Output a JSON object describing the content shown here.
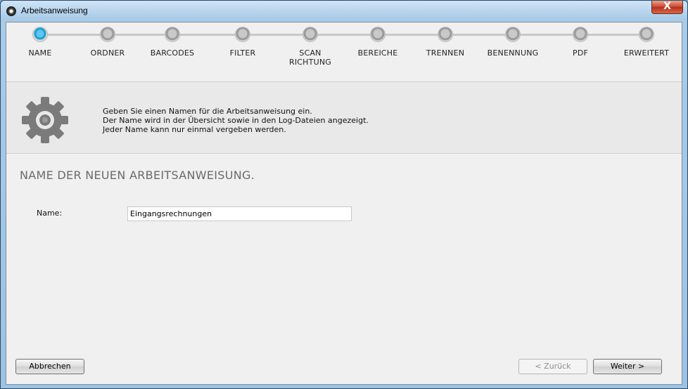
{
  "window": {
    "title": "Arbeitsanweisung",
    "close_label": "X"
  },
  "steps": [
    {
      "label": "NAME",
      "active": true
    },
    {
      "label": "ORDNER",
      "active": false
    },
    {
      "label": "BARCODES",
      "active": false
    },
    {
      "label": "FILTER",
      "active": false
    },
    {
      "label": "SCAN RICHTUNG",
      "active": false
    },
    {
      "label": "BEREICHE",
      "active": false
    },
    {
      "label": "TRENNEN",
      "active": false
    },
    {
      "label": "BENENNUNG",
      "active": false
    },
    {
      "label": "PDF",
      "active": false
    },
    {
      "label": "ERWEITERT",
      "active": false
    }
  ],
  "info": {
    "line1": "Geben Sie einen Namen für die Arbeitsanweisung ein.",
    "line2": "Der Name wird in der Übersicht sowie in den Log-Dateien angezeigt.",
    "line3": "Jeder Name kann nur einmal vergeben werden."
  },
  "form": {
    "section_title": "NAME DER NEUEN ARBEITSANWEISUNG.",
    "name_label": "Name:",
    "name_value": "Eingangsrechnungen"
  },
  "buttons": {
    "cancel": "Abbrechen",
    "back": "< Zurück",
    "next": "Weiter >"
  },
  "colors": {
    "active_step": "#1a9fd6",
    "inactive_step": "#9a9a9a"
  }
}
